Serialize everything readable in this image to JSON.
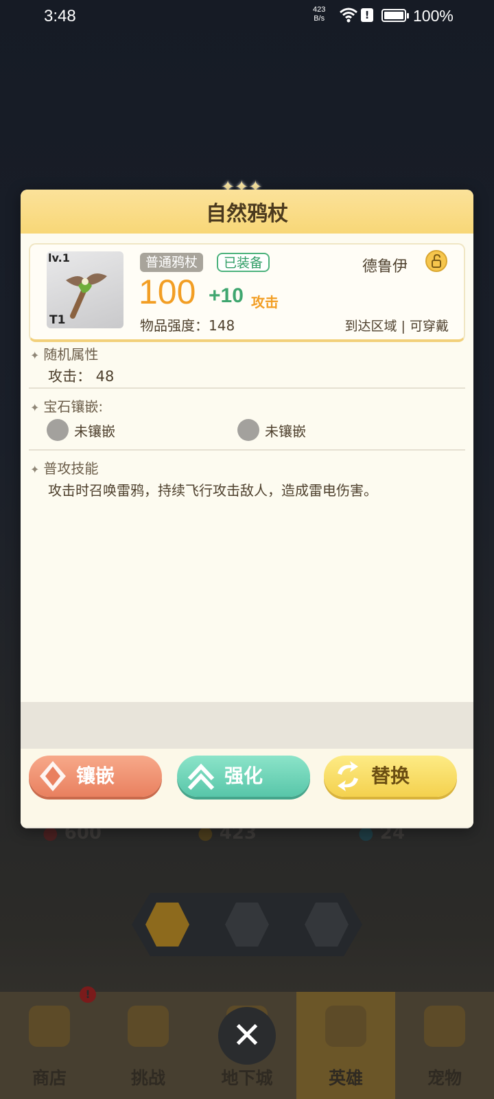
{
  "status_bar": {
    "time": "3:48",
    "net_speed_value": "423",
    "net_speed_unit": "B/s",
    "battery": "100%"
  },
  "dialog": {
    "title": "自然鸦杖",
    "item": {
      "level": "lv.1",
      "tier": "T1",
      "type_tag": "普通鸦杖",
      "equipped_tag": "已装备",
      "class_name": "德鲁伊",
      "attack_base": "100",
      "attack_bonus": "+10",
      "attack_label": "攻击",
      "strength": "物品强度：148",
      "region": "到达区域 | 可穿戴"
    },
    "random_attr": {
      "title": "随机属性",
      "line": "攻击： 48"
    },
    "gems": {
      "title": "宝石镶嵌:",
      "slots": [
        {
          "label": "未镶嵌"
        },
        {
          "label": "未镶嵌"
        }
      ]
    },
    "skill": {
      "title": "普攻技能",
      "desc": "攻击时召唤雷鸦，持续飞行攻击敌人，造成雷电伤害。"
    },
    "buttons": {
      "inlay": "镶嵌",
      "enhance": "强化",
      "replace": "替换"
    }
  },
  "background": {
    "stats": [
      "600",
      "423",
      "24"
    ]
  },
  "bottom_nav": {
    "items": [
      {
        "label": "商店"
      },
      {
        "label": "挑战"
      },
      {
        "label": "地下城"
      },
      {
        "label": "英雄"
      },
      {
        "label": "宠物"
      }
    ],
    "badge": "!",
    "active": "英雄"
  },
  "close_symbol": "✕",
  "colors": {
    "accent_orange": "#f29e24",
    "accent_green": "#3fa66f",
    "header_yellow": "#f8d777"
  }
}
